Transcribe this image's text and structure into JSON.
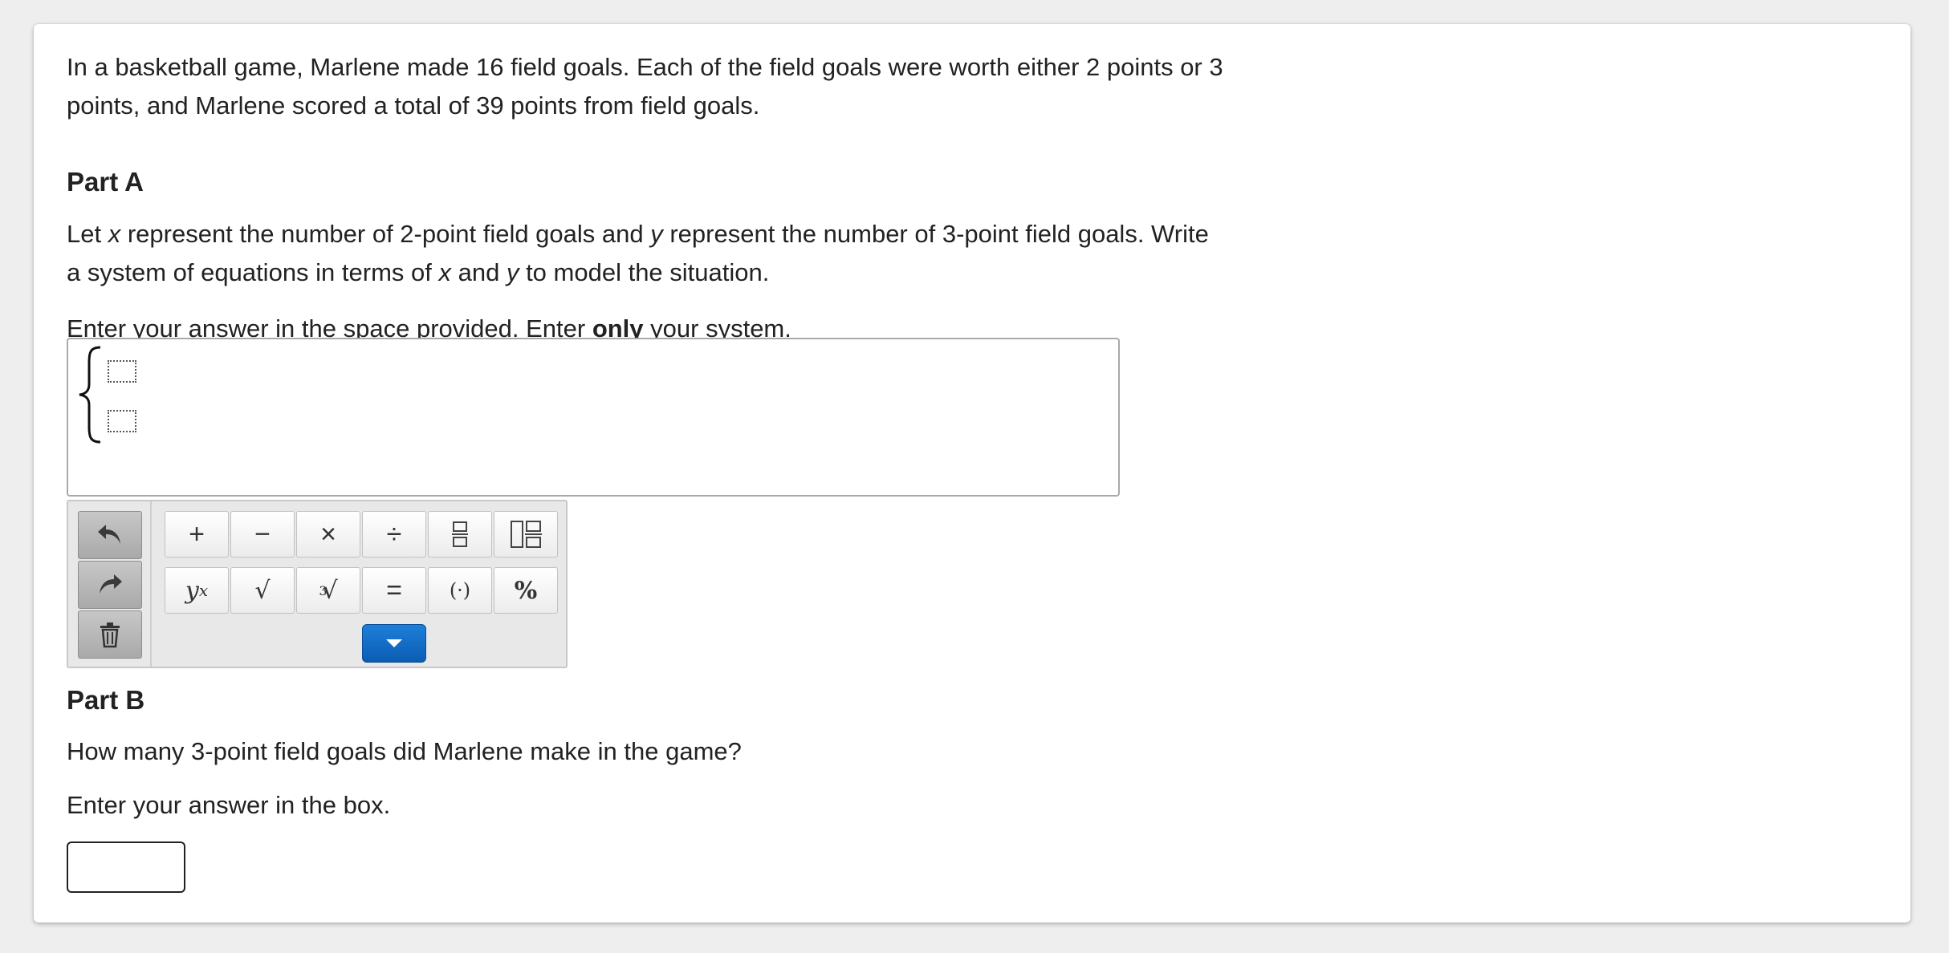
{
  "stem": {
    "line1": "In a basketball game, Marlene made 16 field goals. Each of the field goals were worth either 2 points or 3",
    "line2": "points, and Marlene scored a total of 39 points from field goals."
  },
  "partA": {
    "title": "Part A",
    "text_1": "Let ",
    "var_x": "x",
    "text_2": " represent the number of 2-point field goals and ",
    "var_y": "y",
    "text_3": " represent the number of 3-point field goals. Write",
    "text_4": "a system of equations in terms of ",
    "var_x2": "x",
    "text_5": " and ",
    "var_y2": "y",
    "text_6": " to model the situation.",
    "instr_1": "Enter your answer in the space provided. Enter ",
    "instr_bold": "only",
    "instr_2": " your system."
  },
  "keypad": {
    "row1": [
      "+",
      "−",
      "×",
      "÷",
      "fraction",
      "mixed-fraction"
    ],
    "row2_exponent_base": "y",
    "row2_exponent_sup": "x",
    "sqrt": "√",
    "cbrt_index": "3",
    "equals": "=",
    "parens": "(·)",
    "percent": "%",
    "accent_color": "#1474cc"
  },
  "partB": {
    "title": "Part B",
    "question": "How many 3-point field goals did Marlene make in the game?",
    "instruction": "Enter your answer in the box."
  }
}
